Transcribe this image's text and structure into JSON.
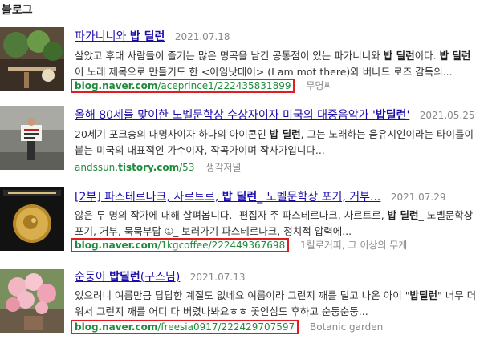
{
  "section_title": "블로그",
  "items": [
    {
      "title_pre": "파가니니와 ",
      "title_bold": "밥 딜런",
      "title_post": "",
      "date": "2021.07.18",
      "desc_1a": "살았고 후대 사람들이 즐기는 많은 명곡을 남긴 공통점이 있는 파가니니와 ",
      "desc_1b": "밥 딜런",
      "desc_1c": "이다. ",
      "desc_1d": "밥 딜런",
      "desc_2": "이 노래 제목으로 만들기도 한 <아임낫데어> (I am mot there)와 버나드 로즈 감독의...",
      "url_host": "blog.naver.com",
      "url_path": "/aceprince1/222435831899",
      "author": "무명씨"
    },
    {
      "title_pre": "올해 80세를 맞이한 노벨문학상 수상자이자 미국의 대중음악가 '",
      "title_bold": "밥딜런",
      "title_post": "'",
      "date": "2021.05.25",
      "desc_1a": "20세기 포크송의 대명사이자 하나의 아이콘인 ",
      "desc_1b": "밥 딜런",
      "desc_1c": ", 그는 노래하는 음유시인이라는 타이틀이",
      "desc_2": "붙는 미국의 대표적인 가수이자, 작곡가이며 작사가입니다...",
      "url_host": "andssun.",
      "url_mid": "tistory.com",
      "url_path": "/53",
      "author": "생각저널"
    },
    {
      "title_pre": "[2부] 파스테르나크, 사르트르, ",
      "title_bold": "밥 딜런",
      "title_post": "_ 노벨문학상 포기, 거부...",
      "date": "2021.07.29",
      "desc_1a": "않은 두 명의 작가에 대해 살펴봅니다. -편집자 주  파스테르나크, 사르트르, ",
      "desc_1b": "밥 딜런",
      "desc_1c": "_ 노벨문학상",
      "desc_2": "포기, 거부, 묵묵부답 ①_ 보러가기   파스테르나크, 정치적 압력에...",
      "url_host": "blog.naver.com",
      "url_path": "/1kgcoffee/222449367698",
      "author": "1킬로커피, 그 이상의 무게"
    },
    {
      "title_pre": "순둥이 ",
      "title_bold": "밥딜런",
      "title_post": "(구스님)",
      "date": "2021.07.13",
      "desc_1a": "있으려니 여름만큼 답답한 계절도 없네요 여름이라 그런지 깨를 털고 나온 아이 \"",
      "desc_1b": "밥딜런",
      "desc_1c": "\" 너무 더",
      "desc_2": "워서 그런지 깨를 어디 다 버렸나봐요ㅎㅎ 꽃인심도 후하고 순둥순둥...",
      "url_host": "blog.naver.com",
      "url_path": "/freesia0917/222429707597",
      "author": "Botanic garden"
    }
  ],
  "colors": {
    "link": "#1a0dab",
    "url": "#1f8c3b",
    "highlight_box": "#e31c23"
  }
}
